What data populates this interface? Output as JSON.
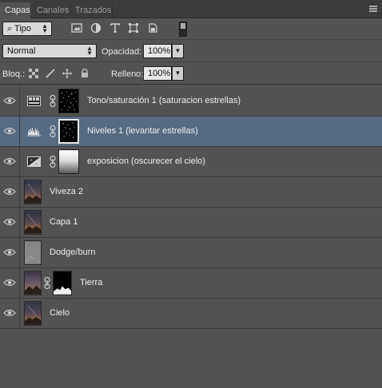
{
  "tabs": [
    {
      "label": "Capas",
      "active": true
    },
    {
      "label": "Canales",
      "active": false
    },
    {
      "label": "Trazados",
      "active": false
    }
  ],
  "filter": {
    "kind_value": "Tipo",
    "icons": [
      "image-filter-icon",
      "adjustment-filter-icon",
      "type-filter-icon",
      "shape-filter-icon",
      "smart-object-filter-icon"
    ]
  },
  "blend": {
    "mode_value": "Normal",
    "opacity_label": "Opacidad:",
    "opacity_value": "100%"
  },
  "lock": {
    "label": "Bloq.:",
    "fill_label": "Relleno:",
    "fill_value": "100%"
  },
  "layers": [
    {
      "name": "Tono/saturación 1 (saturacion estrellas)",
      "type": "hue-saturation",
      "selected": false
    },
    {
      "name": "Niveles 1 (levantar estrellas)",
      "type": "levels",
      "selected": true
    },
    {
      "name": "exposicion (oscurecer el cielo)",
      "type": "exposure",
      "selected": false
    },
    {
      "name": "Viveza 2",
      "type": "pixel",
      "selected": false
    },
    {
      "name": "Capa 1",
      "type": "pixel",
      "selected": false
    },
    {
      "name": "Dodge/burn",
      "type": "gray",
      "selected": false
    },
    {
      "name": "Tierra",
      "type": "pixel-mask",
      "selected": false
    },
    {
      "name": "Cielo",
      "type": "pixel",
      "selected": false
    }
  ],
  "colors": {
    "panel_bg": "#535353",
    "selected_row": "#566a80",
    "tab_bar": "#3c3c3c"
  }
}
